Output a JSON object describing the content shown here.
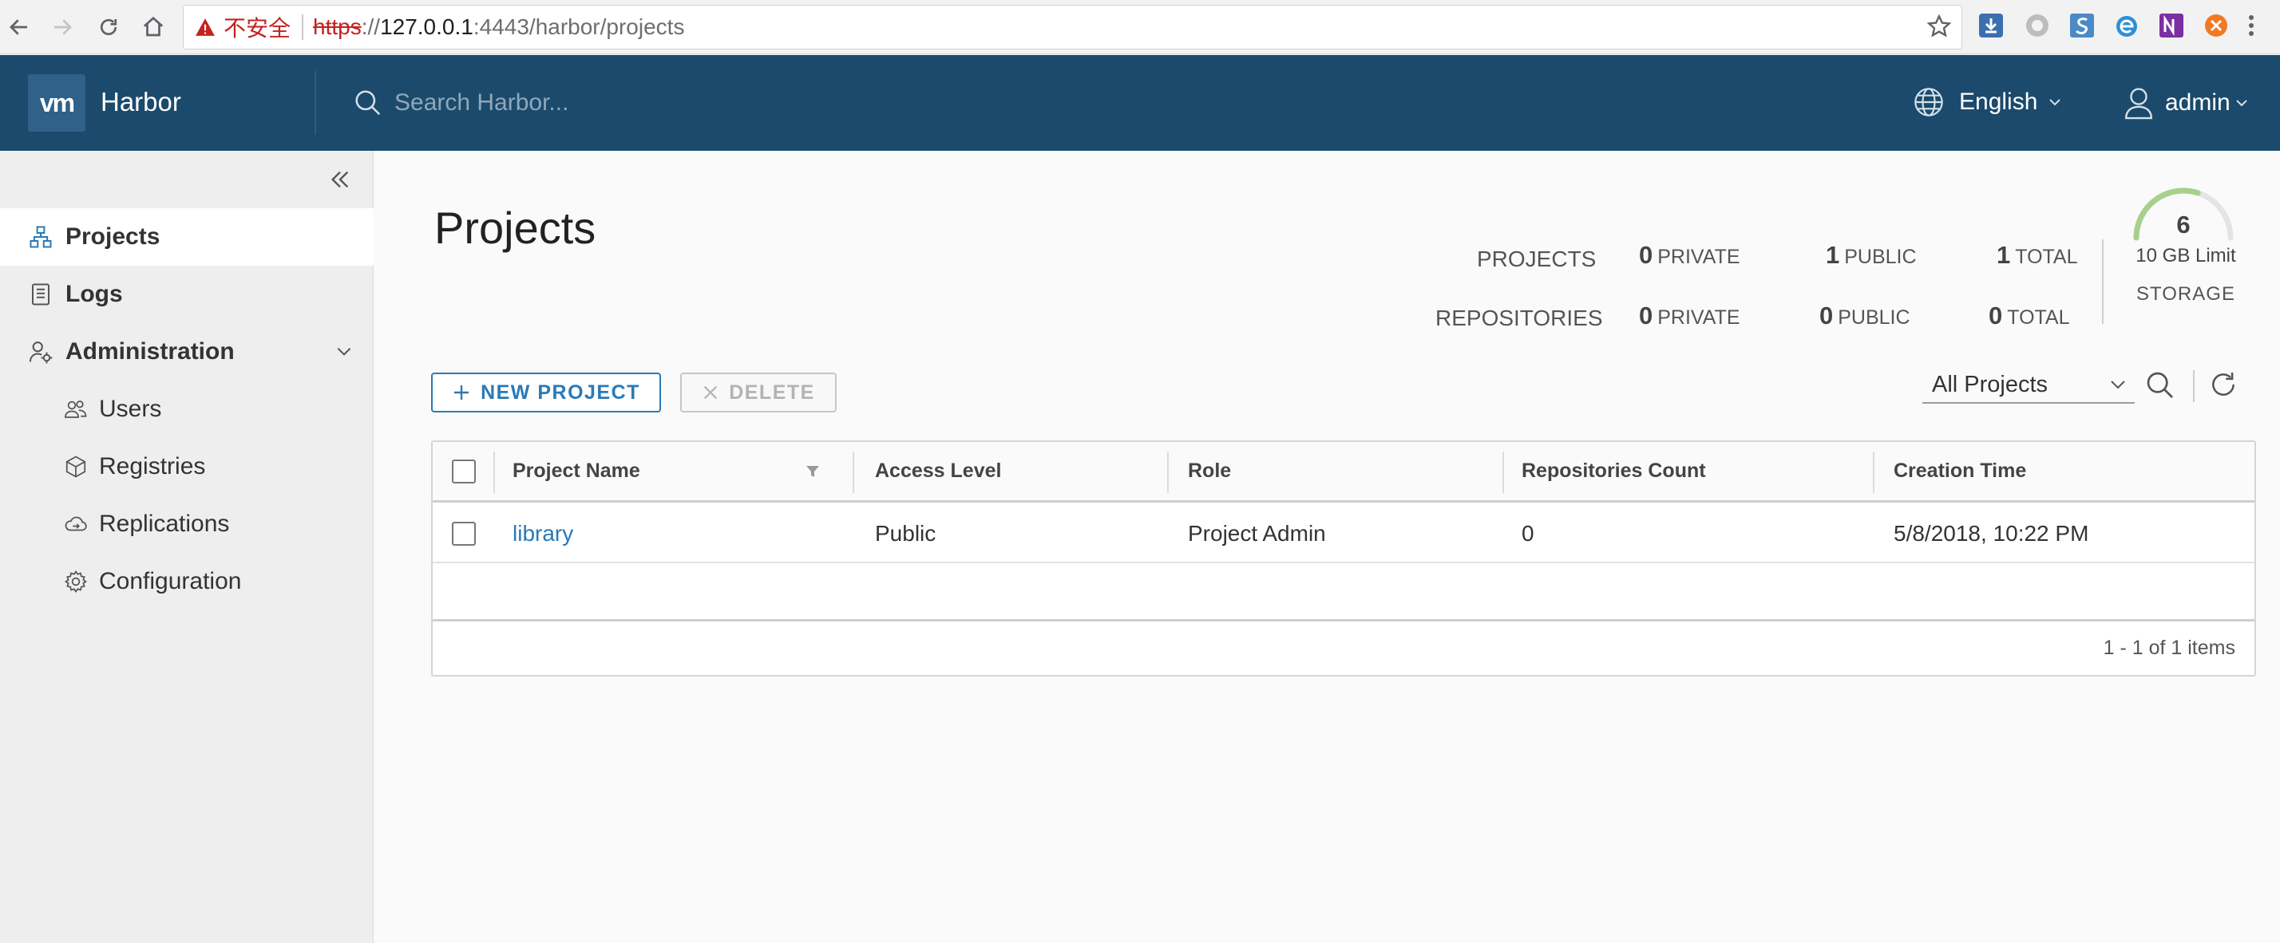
{
  "browser": {
    "insecure_label": "不安全",
    "url_scheme": "https",
    "url_scheme_sep": "://",
    "url_host": "127.0.0.1",
    "url_path": ":4443/harbor/projects"
  },
  "header": {
    "logo_text": "vm",
    "app_name": "Harbor",
    "search_placeholder": "Search Harbor...",
    "language": "English",
    "user": "admin"
  },
  "sidebar": {
    "items": [
      {
        "label": "Projects",
        "icon": "projects-icon",
        "active": true
      },
      {
        "label": "Logs",
        "icon": "logs-icon"
      },
      {
        "label": "Administration",
        "icon": "administration-icon"
      },
      {
        "label": "Users",
        "icon": "users-icon"
      },
      {
        "label": "Registries",
        "icon": "registries-icon"
      },
      {
        "label": "Replications",
        "icon": "replications-icon"
      },
      {
        "label": "Configuration",
        "icon": "configuration-icon"
      }
    ]
  },
  "main": {
    "title": "Projects",
    "stats": {
      "projects_label": "PROJECTS",
      "repositories_label": "REPOSITORIES",
      "private_label": "PRIVATE",
      "public_label": "PUBLIC",
      "total_label": "TOTAL",
      "projects_private": "0",
      "projects_public": "1",
      "projects_total": "1",
      "repos_private": "0",
      "repos_public": "0",
      "repos_total": "0"
    },
    "storage": {
      "count": "6",
      "limit": "10 GB Limit",
      "label": "STORAGE",
      "used_fraction": 0.6
    },
    "toolbar": {
      "new_project": "NEW PROJECT",
      "delete": "DELETE",
      "filter_selected": "All Projects"
    },
    "grid": {
      "columns": [
        "Project Name",
        "Access Level",
        "Role",
        "Repositories Count",
        "Creation Time"
      ],
      "rows": [
        {
          "name": "library",
          "access": "Public",
          "role": "Project Admin",
          "repo_count": "0",
          "created": "5/8/2018, 10:22 PM"
        }
      ],
      "footer": "1 - 1 of 1 items"
    }
  },
  "colors": {
    "header_bg": "#1b4a6c",
    "accent": "#2a7ab8",
    "gauge": "#a8d08d"
  }
}
